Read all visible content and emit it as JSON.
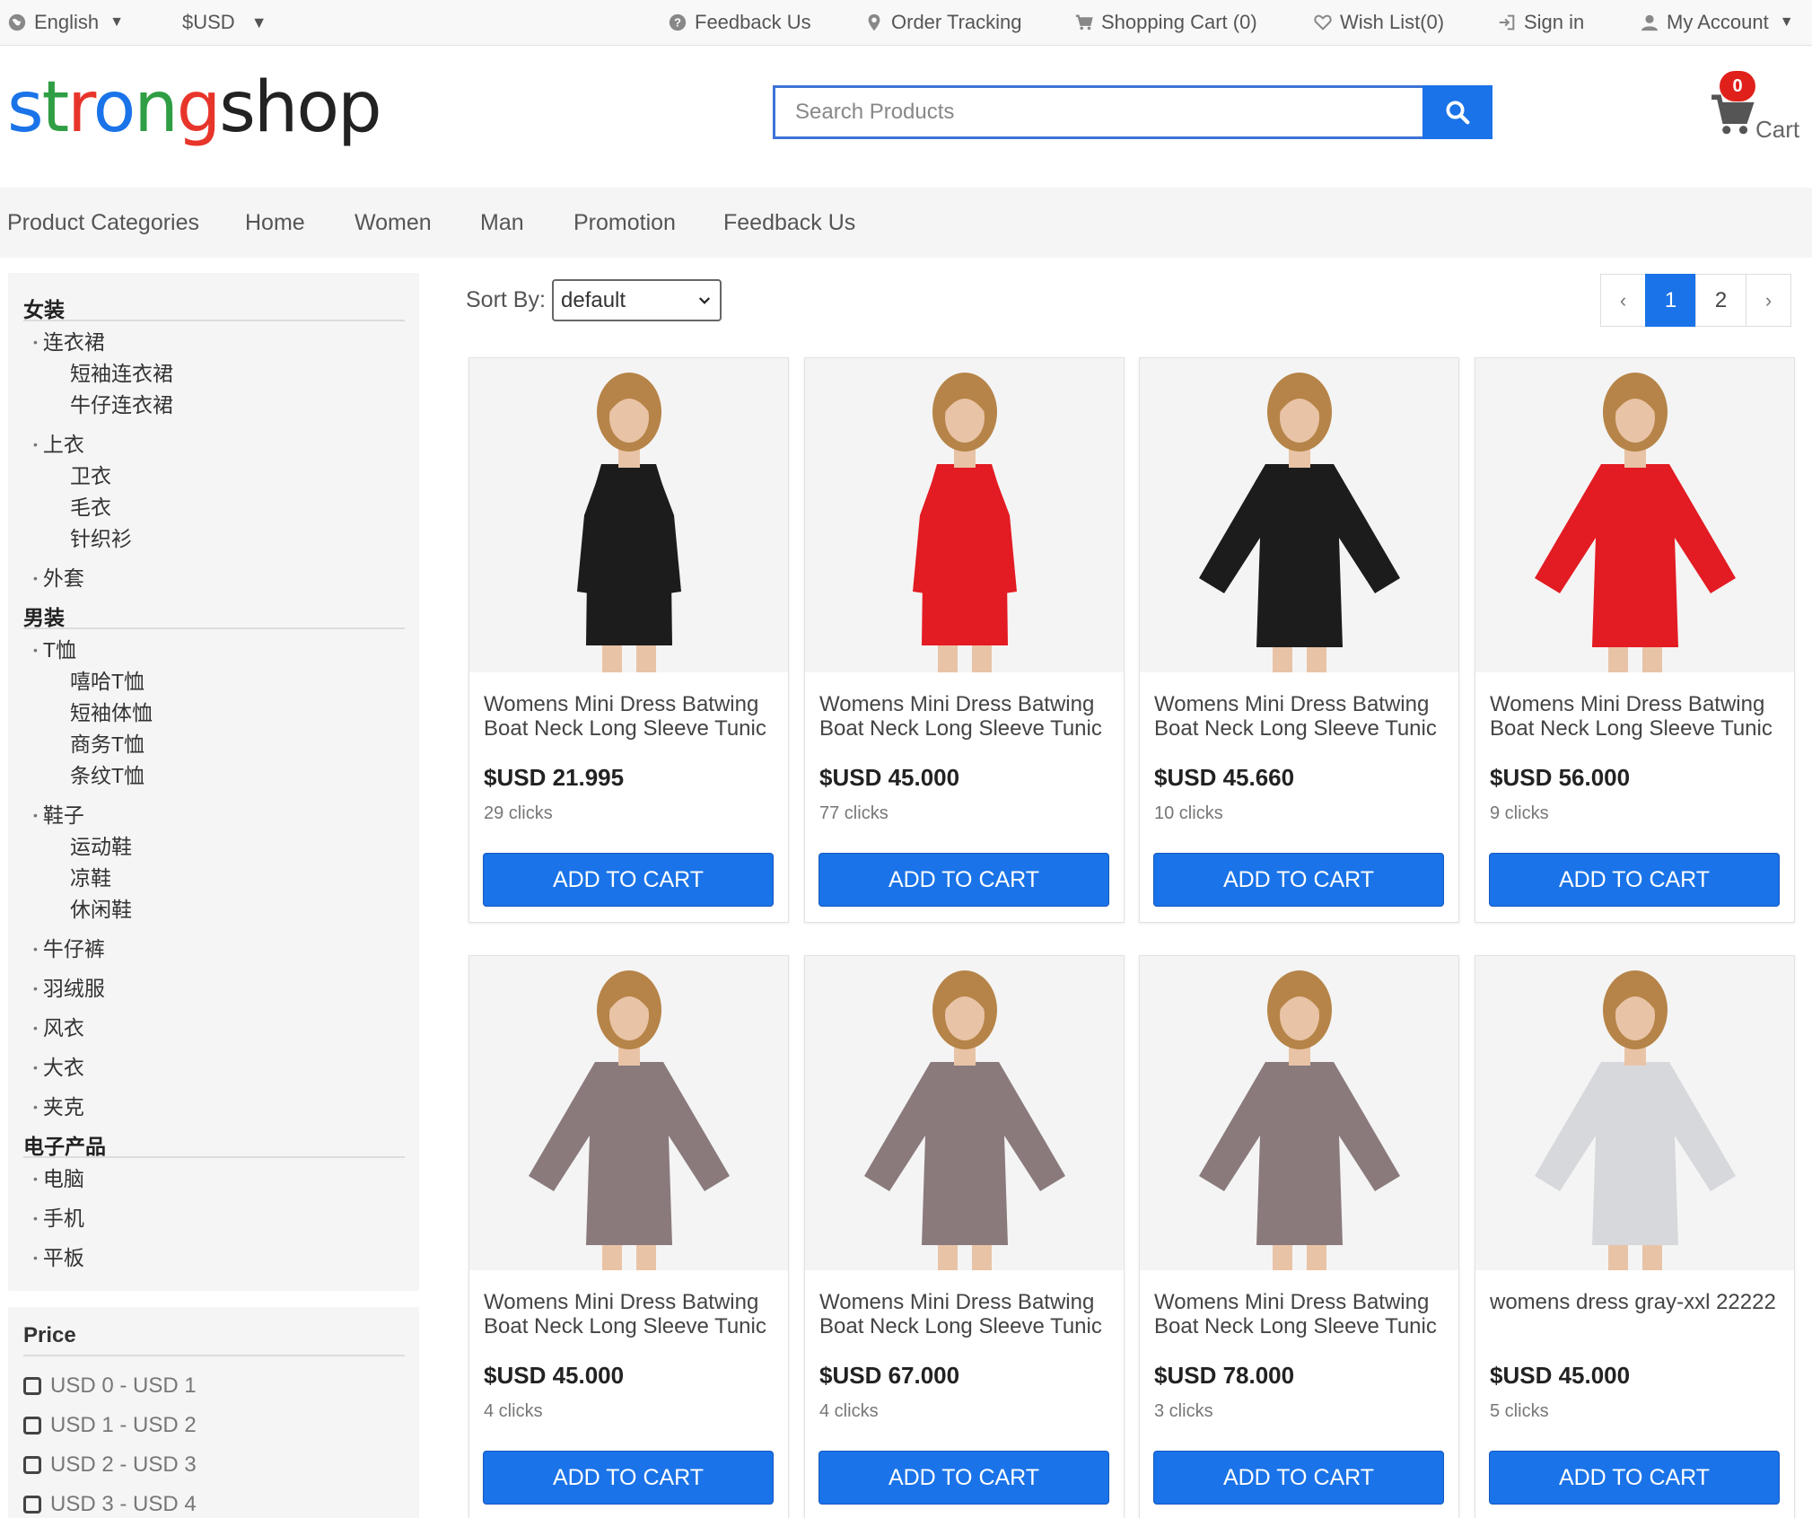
{
  "topbar": {
    "language": "English",
    "currency": "$USD",
    "feedback": "Feedback Us",
    "order_tracking": "Order Tracking",
    "shopping_cart": "Shopping Cart (0)",
    "wish_list": "Wish List(0)",
    "sign_in": "Sign in",
    "my_account": "My Account"
  },
  "brand": {
    "letters": [
      "s",
      "t",
      "r",
      "o",
      "n",
      "g",
      "s",
      "h",
      "o",
      "p"
    ],
    "colors": [
      "#1a73e8",
      "#2f9e44",
      "#e8352b",
      "#1a73e8",
      "#2f9e44",
      "#e8352b",
      "#222222",
      "#222222",
      "#222222",
      "#222222"
    ]
  },
  "search": {
    "placeholder": "Search Products"
  },
  "cart": {
    "count": "0",
    "label": "Cart"
  },
  "nav": [
    "Product Categories",
    "Home",
    "Women",
    "Man",
    "Promotion",
    "Feedback Us"
  ],
  "categories": [
    {
      "name": "女装",
      "subs": [
        {
          "name": "连衣裙",
          "leaves": [
            "短袖连衣裙",
            "牛仔连衣裙"
          ]
        },
        {
          "name": "上衣",
          "leaves": [
            "卫衣",
            "毛衣",
            "针织衫"
          ]
        },
        {
          "name": "外套",
          "leaves": []
        }
      ]
    },
    {
      "name": "男装",
      "subs": [
        {
          "name": "T恤",
          "leaves": [
            "嘻哈T恤",
            "短袖体恤",
            "商务T恤",
            "条纹T恤"
          ]
        },
        {
          "name": "鞋子",
          "leaves": [
            "运动鞋",
            "凉鞋",
            "休闲鞋"
          ]
        },
        {
          "name": "牛仔裤",
          "leaves": []
        },
        {
          "name": "羽绒服",
          "leaves": []
        },
        {
          "name": "风衣",
          "leaves": []
        },
        {
          "name": "大衣",
          "leaves": []
        },
        {
          "name": "夹克",
          "leaves": []
        }
      ]
    },
    {
      "name": "电子产品",
      "subs": [
        {
          "name": "电脑",
          "leaves": []
        },
        {
          "name": "手机",
          "leaves": []
        },
        {
          "name": "平板",
          "leaves": []
        }
      ]
    }
  ],
  "price_filter": {
    "title": "Price",
    "options": [
      "USD 0 - USD 1",
      "USD 1 - USD 2",
      "USD 2 - USD 3",
      "USD 3 - USD 4"
    ]
  },
  "sort": {
    "label": "Sort By:",
    "selected": "default"
  },
  "pagination": {
    "prev": "‹",
    "pages": [
      "1",
      "2"
    ],
    "current": "1",
    "next": "›"
  },
  "add_to_cart_label": "ADD TO CART",
  "products": [
    {
      "title": "Womens Mini Dress Batwing Boat Neck Long Sleeve Tunic",
      "price": "$USD 21.995",
      "clicks": "29 clicks",
      "dress_color": "#1c1c1c",
      "style": "slim"
    },
    {
      "title": "Womens Mini Dress Batwing Boat Neck Long Sleeve Tunic",
      "price": "$USD 45.000",
      "clicks": "77 clicks",
      "dress_color": "#e31b23",
      "style": "slim"
    },
    {
      "title": "Womens Mini Dress Batwing Boat Neck Long Sleeve Tunic",
      "price": "$USD 45.660",
      "clicks": "10 clicks",
      "dress_color": "#1c1c1c",
      "style": "batwing"
    },
    {
      "title": "Womens Mini Dress Batwing Boat Neck Long Sleeve Tunic",
      "price": "$USD 56.000",
      "clicks": "9 clicks",
      "dress_color": "#e31b23",
      "style": "batwing"
    },
    {
      "title": "Womens Mini Dress Batwing Boat Neck Long Sleeve Tunic",
      "price": "$USD 45.000",
      "clicks": "4 clicks",
      "dress_color": "#8a7a7c",
      "style": "batwing"
    },
    {
      "title": "Womens Mini Dress Batwing Boat Neck Long Sleeve Tunic",
      "price": "$USD 67.000",
      "clicks": "4 clicks",
      "dress_color": "#8a7a7c",
      "style": "batwing"
    },
    {
      "title": "Womens Mini Dress Batwing Boat Neck Long Sleeve Tunic",
      "price": "$USD 78.000",
      "clicks": "3 clicks",
      "dress_color": "#8a7a7c",
      "style": "batwing"
    },
    {
      "title": "womens dress gray-xxl 22222",
      "price": "$USD 45.000",
      "clicks": "5 clicks",
      "dress_color": "#d6d8dc",
      "style": "batwing"
    }
  ]
}
